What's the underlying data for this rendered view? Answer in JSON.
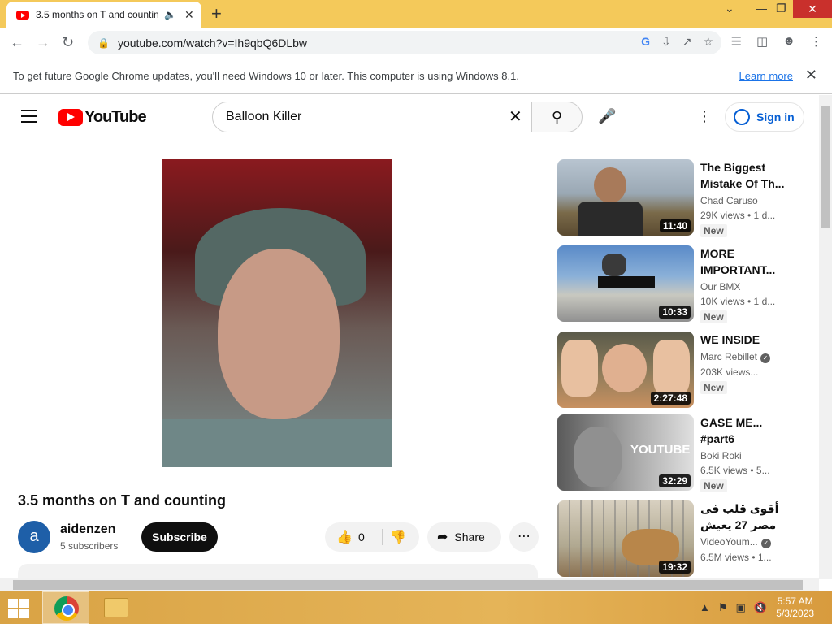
{
  "browser": {
    "tab_title": "3.5 months on T and counting",
    "url": "youtube.com/watch?v=Ih9qbQ6DLbw"
  },
  "infobar": {
    "message": "To get future Google Chrome updates, you'll need Windows 10 or later. This computer is using Windows 8.1.",
    "link": "Learn more"
  },
  "youtube": {
    "logo_text": "YouTube",
    "search_value": "Balloon Killer",
    "sign_in": "Sign in"
  },
  "video": {
    "title": "3.5 months on T and counting",
    "channel": "aidenzen",
    "avatar_letter": "a",
    "subscribers": "5 subscribers",
    "subscribe_label": "Subscribe",
    "likes": "0",
    "share_label": "Share"
  },
  "recommendations": [
    {
      "title": "The Biggest Mistake Of Th...",
      "channel": "Chad Caruso",
      "views": "29K views  •  1 d...",
      "badge": "New",
      "duration": "11:40",
      "verified": false
    },
    {
      "title": "MORE IMPORTANT...",
      "channel": "Our BMX",
      "views": "10K views  •  1 d...",
      "badge": "New",
      "duration": "10:33",
      "verified": false
    },
    {
      "title": "WE INSIDE",
      "channel": "Marc Rebillet",
      "views": "203K views...",
      "badge": "New",
      "duration": "2:27:48",
      "verified": true
    },
    {
      "title": "GASE ME... #part6",
      "channel": "Boki Roki",
      "views": "6.5K views  •  5...",
      "badge": "New",
      "duration": "32:29",
      "verified": false
    },
    {
      "title": "أقوى قلب فى مصر 27 يعيش وسط...",
      "channel": "VideoYoum...",
      "views": "6.5M views  •  1...",
      "badge": "",
      "duration": "19:32",
      "verified": true
    }
  ],
  "taskbar": {
    "time": "5:57 AM",
    "date": "5/3/2023"
  },
  "colors": {
    "youtube_red": "#ff0000",
    "link_blue": "#065fd4",
    "chrome_frame": "#f4c95a"
  }
}
